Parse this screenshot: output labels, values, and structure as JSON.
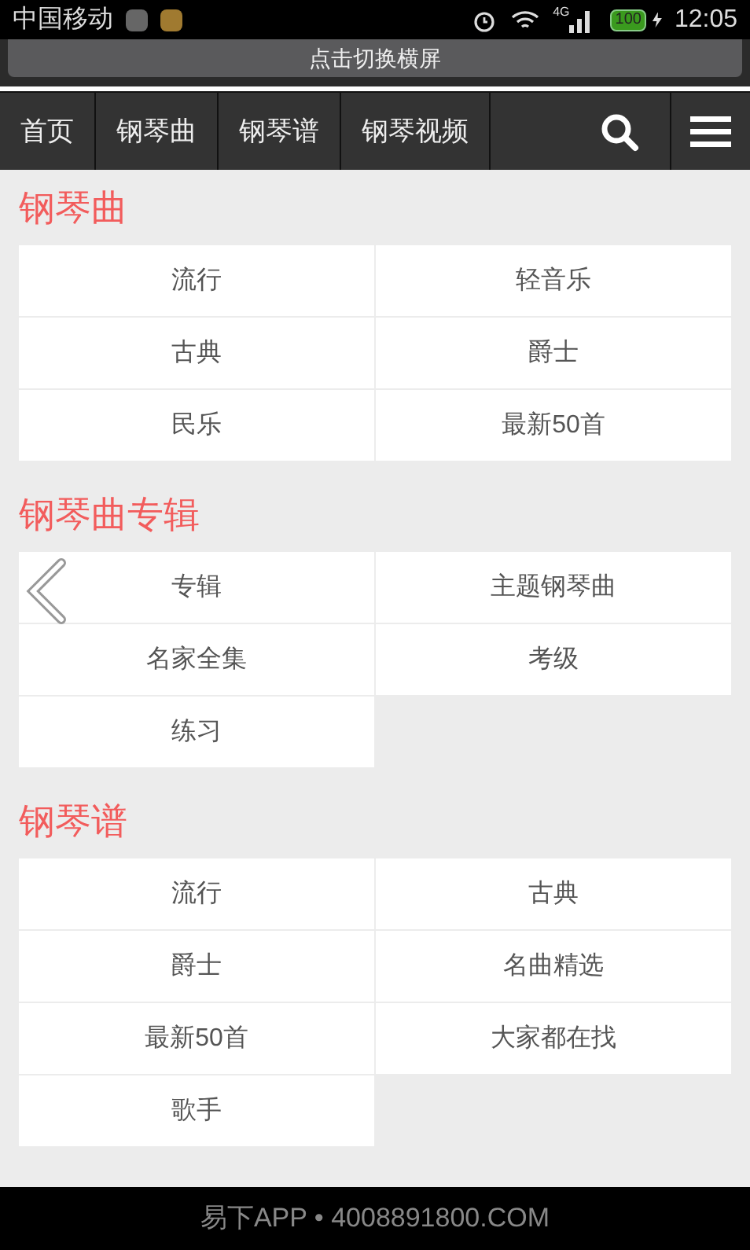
{
  "status_bar": {
    "carrier": "中国移动",
    "network": "4G",
    "battery": "100",
    "time": "12:05"
  },
  "rotate_button": "点击切换横屏",
  "nav": [
    {
      "label": "首页",
      "selected": false
    },
    {
      "label": "钢琴曲",
      "selected": false
    },
    {
      "label": "钢琴谱",
      "selected": false
    },
    {
      "label": "钢琴视频",
      "selected": false
    }
  ],
  "sections": [
    {
      "title": "钢琴曲",
      "items": [
        "流行",
        "轻音乐",
        "古典",
        "爵士",
        "民乐",
        "最新50首"
      ],
      "has_arrow": false
    },
    {
      "title": "钢琴曲专辑",
      "items": [
        "专辑",
        "主题钢琴曲",
        "名家全集",
        "考级",
        "练习"
      ],
      "has_arrow": true
    },
    {
      "title": "钢琴谱",
      "items": [
        "流行",
        "古典",
        "爵士",
        "名曲精选",
        "最新50首",
        "大家都在找",
        "歌手"
      ],
      "has_arrow": false
    }
  ],
  "footer": "易下APP • 4008891800.COM"
}
